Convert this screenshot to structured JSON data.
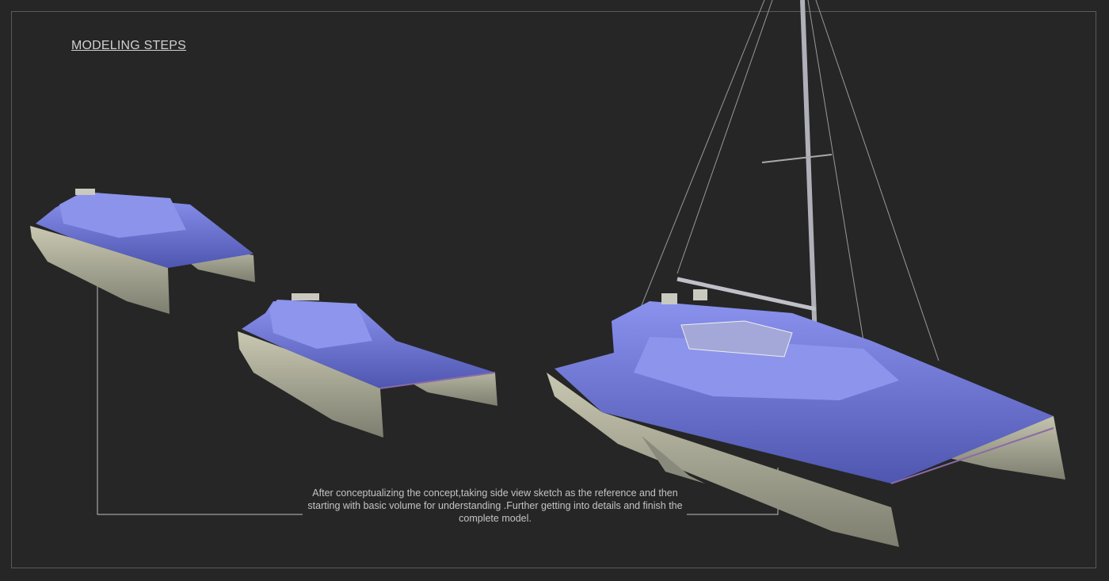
{
  "slide": {
    "title": "MODELING STEPS",
    "caption": "After conceptualizing the concept,taking side view sketch as the reference and then starting with basic volume for understanding .Further getting into details and finish the complete model."
  },
  "colors": {
    "background": "#262626",
    "deck": "#6a74d8",
    "hull": "#b8b8a4",
    "frame": "#5a5a5a"
  }
}
